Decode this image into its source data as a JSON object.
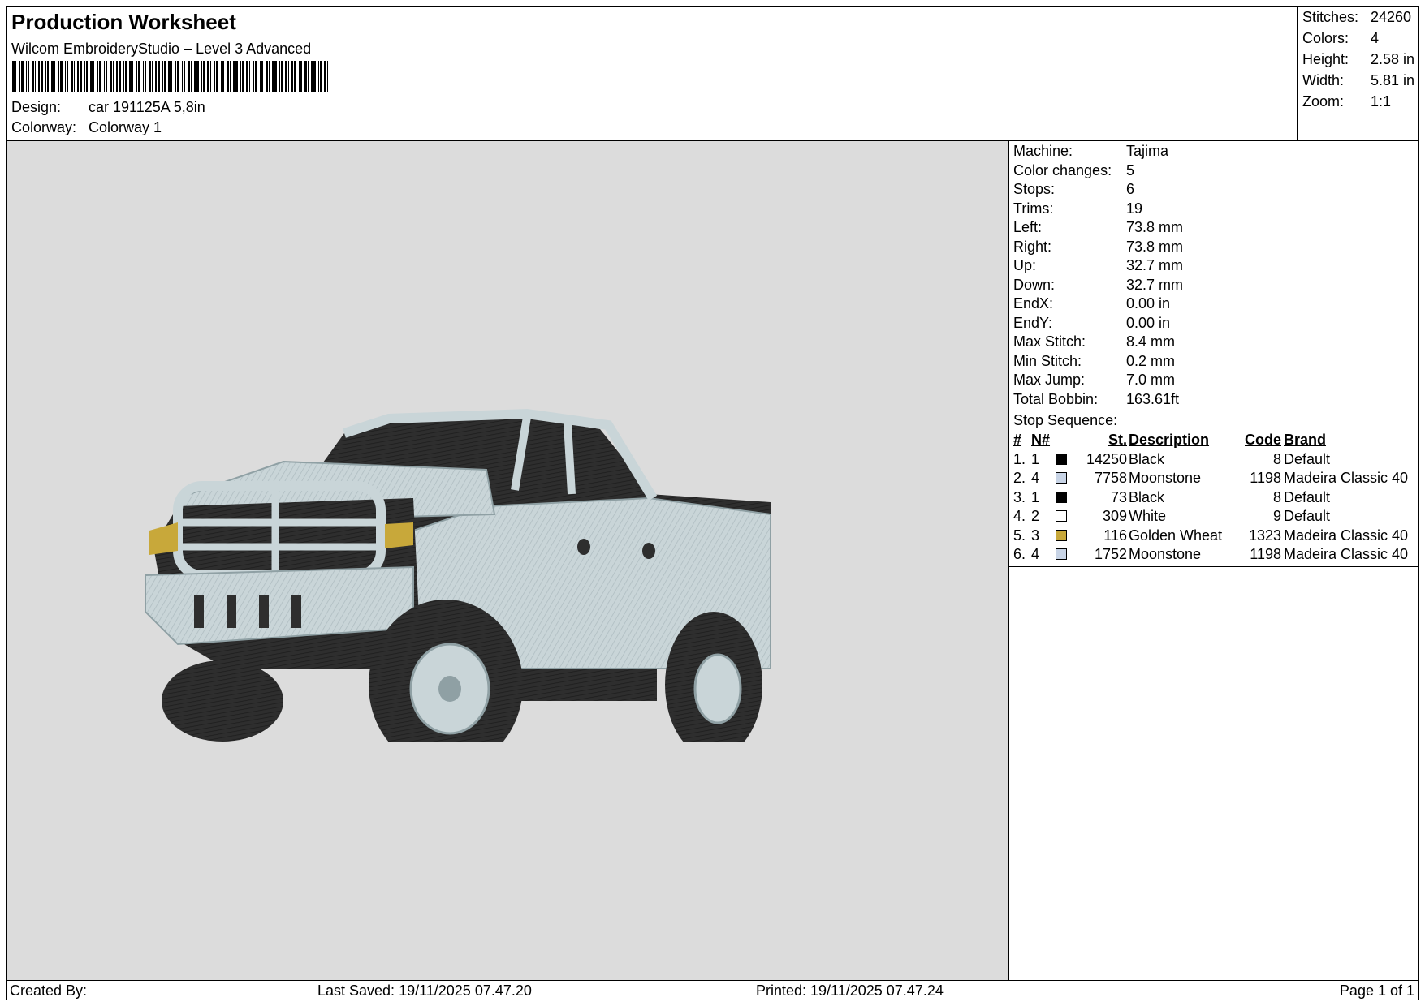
{
  "header": {
    "title": "Production Worksheet",
    "subtitle": "Wilcom EmbroideryStudio – Level 3 Advanced",
    "design_label": "Design:",
    "design_value": "car 191125A 5,8in",
    "colorway_label": "Colorway:",
    "colorway_value": "Colorway 1"
  },
  "stats": {
    "stitches_label": "Stitches:",
    "stitches_value": "24260",
    "colors_label": "Colors:",
    "colors_value": "4",
    "height_label": "Height:",
    "height_value": "2.58 in",
    "width_label": "Width:",
    "width_value": "5.81 in",
    "zoom_label": "Zoom:",
    "zoom_value": "1:1"
  },
  "machine_info": [
    {
      "label": "Machine:",
      "value": "Tajima"
    },
    {
      "label": "Color changes:",
      "value": "5"
    },
    {
      "label": "Stops:",
      "value": "6"
    },
    {
      "label": "Trims:",
      "value": "19"
    },
    {
      "label": "Left:",
      "value": "73.8 mm"
    },
    {
      "label": "Right:",
      "value": "73.8 mm"
    },
    {
      "label": "Up:",
      "value": "32.7 mm"
    },
    {
      "label": "Down:",
      "value": "32.7 mm"
    },
    {
      "label": "EndX:",
      "value": "0.00 in"
    },
    {
      "label": "EndY:",
      "value": "0.00 in"
    },
    {
      "label": "Max Stitch:",
      "value": "8.4 mm"
    },
    {
      "label": "Min Stitch:",
      "value": "0.2 mm"
    },
    {
      "label": "Max Jump:",
      "value": "7.0 mm"
    },
    {
      "label": "Total Bobbin:",
      "value": "163.61ft"
    }
  ],
  "stop_sequence": {
    "title": "Stop Sequence:",
    "headers": {
      "idx": "#",
      "n": "N#",
      "st": "St.",
      "desc": "Description",
      "code": "Code",
      "brand": "Brand"
    },
    "rows": [
      {
        "idx": "1.",
        "n": "1",
        "color": "#000000",
        "st": "14250",
        "desc": "Black",
        "code": "8",
        "brand": "Default"
      },
      {
        "idx": "2.",
        "n": "4",
        "color": "#c8d4e6",
        "st": "7758",
        "desc": "Moonstone",
        "code": "1198",
        "brand": "Madeira Classic 40"
      },
      {
        "idx": "3.",
        "n": "1",
        "color": "#000000",
        "st": "73",
        "desc": "Black",
        "code": "8",
        "brand": "Default"
      },
      {
        "idx": "4.",
        "n": "2",
        "color": "#ffffff",
        "st": "309",
        "desc": "White",
        "code": "9",
        "brand": "Default"
      },
      {
        "idx": "5.",
        "n": "3",
        "color": "#c8a83a",
        "st": "116",
        "desc": "Golden Wheat",
        "code": "1323",
        "brand": "Madeira Classic 40"
      },
      {
        "idx": "6.",
        "n": "4",
        "color": "#c8d4e6",
        "st": "1752",
        "desc": "Moonstone",
        "code": "1198",
        "brand": "Madeira Classic 40"
      }
    ]
  },
  "footer": {
    "created_by": "Created By:",
    "last_saved": "Last Saved: 19/11/2025 07.47.20",
    "printed": "Printed: 19/11/2025 07.47.24",
    "page": "Page 1 of 1"
  },
  "colors": {
    "preview_bg": "#dcdcdc",
    "truck_body": "#c9d5d8",
    "truck_dark": "#2c2c2c",
    "headlight": "#c8a83a"
  }
}
